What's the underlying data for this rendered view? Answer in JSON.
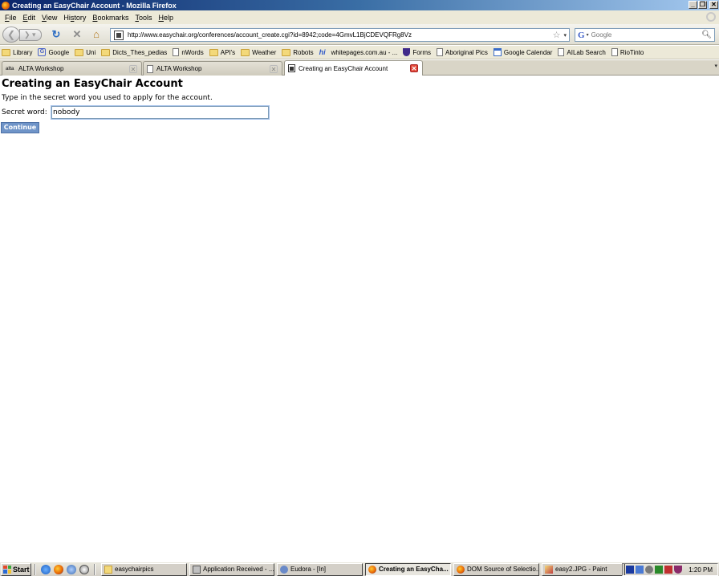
{
  "window": {
    "title": "Creating an EasyChair Account - Mozilla Firefox"
  },
  "menu": [
    "File",
    "Edit",
    "View",
    "History",
    "Bookmarks",
    "Tools",
    "Help"
  ],
  "menu_underline": [
    "F",
    "E",
    "V",
    "s",
    "B",
    "T",
    "H"
  ],
  "nav": {
    "url": "http://www.easychair.org/conferences/account_create.cgi?id=8942;code=4GmvL1BjCDEVQFRg8Vz",
    "search_placeholder": "Google"
  },
  "bookmarks": [
    {
      "label": "Library",
      "icon": "folder"
    },
    {
      "label": "Google",
      "icon": "google"
    },
    {
      "label": "Uni",
      "icon": "folder"
    },
    {
      "label": "Dicts_Thes_pedias",
      "icon": "folder"
    },
    {
      "label": "nWords",
      "icon": "page"
    },
    {
      "label": "API's",
      "icon": "folder"
    },
    {
      "label": "Weather",
      "icon": "folder"
    },
    {
      "label": "Robots",
      "icon": "folder"
    },
    {
      "label": "whitepages.com.au - ...",
      "icon": "hi"
    },
    {
      "label": "Forms",
      "icon": "shield"
    },
    {
      "label": "Aboriginal Pics",
      "icon": "page"
    },
    {
      "label": "Google Calendar",
      "icon": "cal"
    },
    {
      "label": "AILab Search",
      "icon": "page"
    },
    {
      "label": "RioTinto",
      "icon": "page"
    }
  ],
  "tabs": [
    {
      "label": "ALTA Workshop",
      "active": false
    },
    {
      "label": "ALTA Workshop",
      "active": false
    },
    {
      "label": "Creating an EasyChair Account",
      "active": true
    }
  ],
  "page": {
    "title": "Creating an EasyChair Account",
    "instruction": "Type in the secret word you used to apply for the account.",
    "secret_label": "Secret word:",
    "secret_value": "nobody",
    "continue_label": "Continue"
  },
  "taskbar": {
    "start_label": "Start",
    "tasks": [
      {
        "label": "easychairpics",
        "icon": "folder",
        "active": false
      },
      {
        "label": "Application Received - ...",
        "icon": "app",
        "active": false
      },
      {
        "label": "Eudora - [In]",
        "icon": "eudora",
        "active": false
      },
      {
        "label": "Creating an EasyCha...",
        "icon": "firefox",
        "active": true
      },
      {
        "label": "DOM Source of Selectio...",
        "icon": "firefox",
        "active": false
      },
      {
        "label": "easy2.JPG - Paint",
        "icon": "paint",
        "active": false
      }
    ],
    "clock": "1:20 PM"
  }
}
